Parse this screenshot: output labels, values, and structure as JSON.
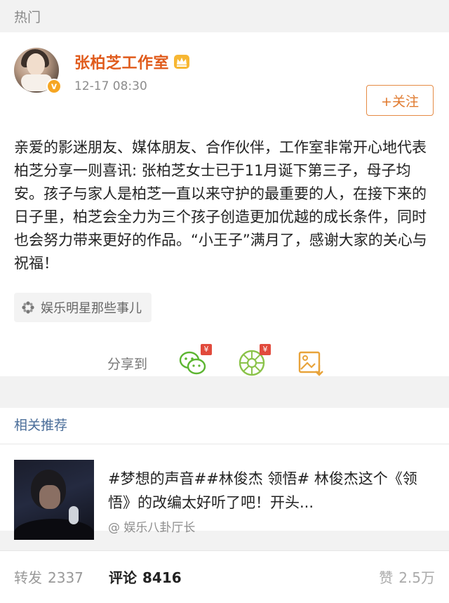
{
  "section": {
    "hot": "热门",
    "related": "相关推荐"
  },
  "post": {
    "user_name": "张柏芝工作室",
    "time": "12-17 08:30",
    "follow_label": "+关注",
    "verified_mark": "v",
    "text": "亲爱的影迷朋友、媒体朋友、合作伙伴，工作室非常开心地代表柏芝分享一则喜讯: 张柏芝女士已于11月诞下第三子，母子均安。孩子与家人是柏芝一直以来守护的最重要的人，在接下来的日子里，柏芝会全力为三个孩子创造更加优越的成长条件，同时也会努力带来更好的作品。“小王子”满月了，感谢大家的关心与祝福！",
    "topic_tag": "娱乐明星那些事儿",
    "share_label": "分享到",
    "badge_symbol": "¥"
  },
  "related": {
    "text": "#梦想的声音##林俊杰 领悟# 林俊杰这个《领悟》的改编太好听了吧！开头...",
    "source": "@ 娱乐八卦厅长"
  },
  "stats": {
    "repost_label": "转发",
    "repost_count": "2337",
    "comment_label": "评论",
    "comment_count": "8416",
    "like_label": "赞",
    "like_count": "2.5万"
  },
  "colors": {
    "name": "#e05b1c",
    "follow": "#e07a2e",
    "related_title": "#4a6d99",
    "badge": "#e14a3c"
  }
}
